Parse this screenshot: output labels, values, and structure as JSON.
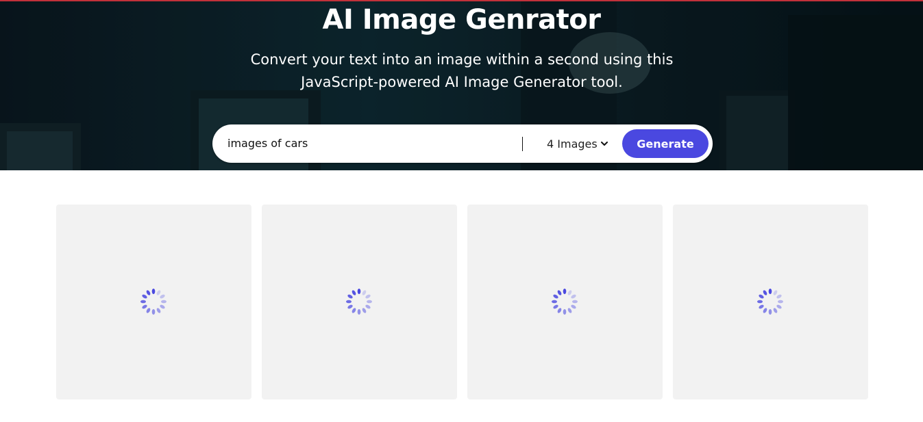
{
  "hero": {
    "title": "AI Image Genrator",
    "subtitle_line1": "Convert your text into an image within a second using this",
    "subtitle_line2": "JavaScript-powered AI Image Generator tool."
  },
  "form": {
    "prompt_value": "images of cars",
    "image_count_selected": "4 Images",
    "generate_label": "Generate"
  },
  "gallery": {
    "cards": [
      {
        "state": "loading"
      },
      {
        "state": "loading"
      },
      {
        "state": "loading"
      },
      {
        "state": "loading"
      }
    ]
  },
  "colors": {
    "accent": "#4a48e0",
    "top_border": "#c2313a",
    "card_bg": "#f2f2f2",
    "spinner": "#4a48e0"
  },
  "icons": {
    "dropdown": "chevron-down-icon",
    "loading": "loading-spinner-icon"
  }
}
